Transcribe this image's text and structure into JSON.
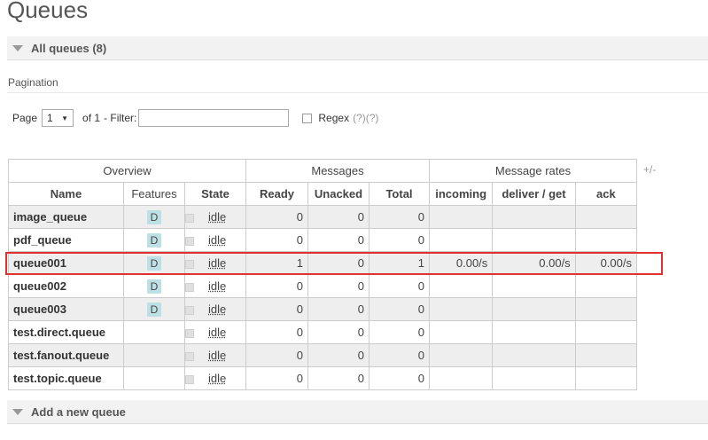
{
  "page_title": "Queues",
  "all_queues_section": {
    "label": "All queues (8)"
  },
  "pagination": {
    "heading": "Pagination",
    "page_label": "Page",
    "page_value": "1",
    "of_label": "of 1",
    "filter_label": "- Filter:",
    "filter_value": "",
    "regex_label": "Regex",
    "help_1": "(?)",
    "help_2": "(?)"
  },
  "table": {
    "groups": {
      "overview": "Overview",
      "messages": "Messages",
      "rates": "Message rates",
      "toggle": "+/-"
    },
    "columns": {
      "name": "Name",
      "features": "Features",
      "state": "State",
      "ready": "Ready",
      "unacked": "Unacked",
      "total": "Total",
      "incoming": "incoming",
      "deliver_get": "deliver / get",
      "ack": "ack"
    },
    "rows": [
      {
        "name": "image_queue",
        "feature": "D",
        "state": "idle",
        "ready": "0",
        "unacked": "0",
        "total": "0",
        "incoming": "",
        "deliver_get": "",
        "ack": ""
      },
      {
        "name": "pdf_queue",
        "feature": "D",
        "state": "idle",
        "ready": "0",
        "unacked": "0",
        "total": "0",
        "incoming": "",
        "deliver_get": "",
        "ack": ""
      },
      {
        "name": "queue001",
        "feature": "D",
        "state": "idle",
        "ready": "1",
        "unacked": "0",
        "total": "1",
        "incoming": "0.00/s",
        "deliver_get": "0.00/s",
        "ack": "0.00/s"
      },
      {
        "name": "queue002",
        "feature": "D",
        "state": "idle",
        "ready": "0",
        "unacked": "0",
        "total": "0",
        "incoming": "",
        "deliver_get": "",
        "ack": ""
      },
      {
        "name": "queue003",
        "feature": "D",
        "state": "idle",
        "ready": "0",
        "unacked": "0",
        "total": "0",
        "incoming": "",
        "deliver_get": "",
        "ack": ""
      },
      {
        "name": "test.direct.queue",
        "feature": "",
        "state": "idle",
        "ready": "0",
        "unacked": "0",
        "total": "0",
        "incoming": "",
        "deliver_get": "",
        "ack": ""
      },
      {
        "name": "test.fanout.queue",
        "feature": "",
        "state": "idle",
        "ready": "0",
        "unacked": "0",
        "total": "0",
        "incoming": "",
        "deliver_get": "",
        "ack": ""
      },
      {
        "name": "test.topic.queue",
        "feature": "",
        "state": "idle",
        "ready": "0",
        "unacked": "0",
        "total": "0",
        "incoming": "",
        "deliver_get": "",
        "ack": ""
      }
    ]
  },
  "add_queue_section": {
    "label": "Add a new queue"
  },
  "colors": {
    "highlight": "#e03030",
    "feature_badge": "#bde0e4"
  }
}
